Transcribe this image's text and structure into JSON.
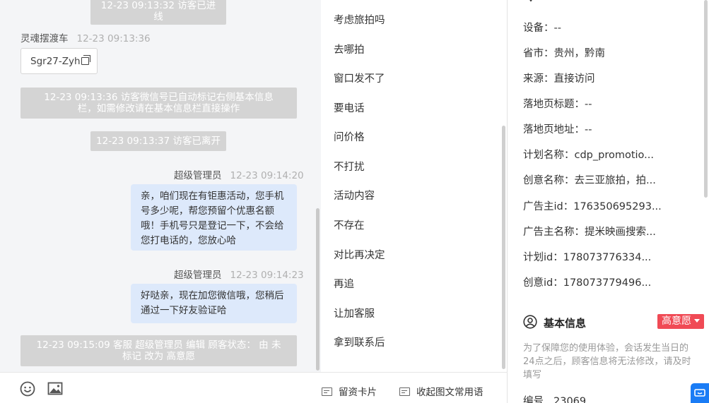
{
  "chat": {
    "top_system_note": "12-23 09:13:32 访客已进线",
    "visitor_msg": {
      "sender": "灵魂摆渡车",
      "time": "12-23 09:13:36",
      "card_text": "Sgr27-Zyh"
    },
    "wechat_note": "12-23 09:13:36 访客微信号已自动标记右侧基本信息栏，如需修改请在基本信息栏直接操作",
    "left_note": "12-23 09:13:37 访客已离开",
    "agent_msgs": [
      {
        "sender": "超级管理员",
        "time": "12-23 09:14:20",
        "text": "亲，咱们现在有钜惠活动，您手机号多少呢，帮您预留个优惠名额哦！手机号只是登记一下，不会给您打电话的，您放心哈"
      },
      {
        "sender": "超级管理员",
        "time": "12-23 09:14:23",
        "text": "好哒亲，现在加您微信哦，您稍后通过一下好友验证哈"
      }
    ],
    "status_note": "12-23 09:15:09 客服 超级管理员 编辑 顾客状态： 由 未标记 改为 高意愿"
  },
  "quick_replies": {
    "items": [
      "考虑旅拍吗",
      "去哪拍",
      "窗口发不了",
      "要电话",
      "问价格",
      "不打扰",
      "活动内容",
      "不存在",
      "对比再决定",
      "再追",
      "让加客服",
      "拿到联系后"
    ],
    "card_btn": "留资卡片",
    "collapse_btn": "收起图文常用语"
  },
  "info": {
    "rows": [
      {
        "label": "设备：",
        "value": "--"
      },
      {
        "label": "省市：",
        "value": "贵州，黔南"
      },
      {
        "label": "来源：",
        "value": "直接访问"
      },
      {
        "label": "落地页标题：",
        "value": "--"
      },
      {
        "label": "落地页地址：",
        "value": "--"
      },
      {
        "label": "计划名称：",
        "value": "cdp_promotio..."
      },
      {
        "label": "创意名称：",
        "value": "去三亚旅拍，拍..."
      },
      {
        "label": "广告主id：",
        "value": "176350695293..."
      },
      {
        "label": "广告主名称：",
        "value": "提米映画搜索..."
      },
      {
        "label": "计划id：",
        "value": "178073776334..."
      },
      {
        "label": "创意id：",
        "value": "178073779496..."
      }
    ],
    "basic_title": "基本信息",
    "intent_tag": "高意愿",
    "notice": "为了保障您的使用体验，会话发生当日的24点之后，顾客信息将无法修改，请及时填写",
    "serial_label": "编号",
    "serial_value": "23069"
  },
  "colors": {
    "accent": "#1a7cf5",
    "intent": "#f04a55",
    "bubble": "#dde9fb",
    "system_note": "#d4d4d4"
  }
}
